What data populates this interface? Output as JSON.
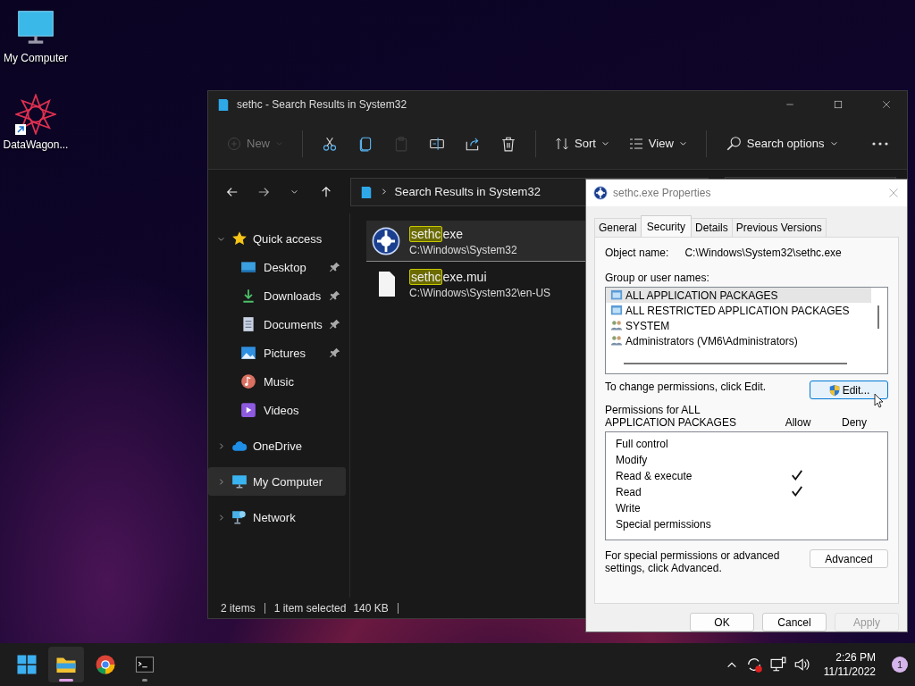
{
  "desktop_icons": [
    {
      "label": "My Computer",
      "kind": "computer",
      "shortcut": false
    },
    {
      "label": "DataWagon...",
      "kind": "app",
      "shortcut": true
    }
  ],
  "explorer": {
    "title": "sethc - Search Results in System32",
    "toolbar": [
      {
        "kind": "new",
        "label": "New",
        "disabled": true,
        "dropdown": true
      },
      {
        "kind": "divider"
      },
      {
        "kind": "cut",
        "disabled": false
      },
      {
        "kind": "copy",
        "disabled": false
      },
      {
        "kind": "paste",
        "disabled": true
      },
      {
        "kind": "rename",
        "disabled": false
      },
      {
        "kind": "share",
        "disabled": false
      },
      {
        "kind": "delete",
        "disabled": false
      },
      {
        "kind": "divider"
      },
      {
        "kind": "sort",
        "label": "Sort",
        "disabled": false,
        "dropdown": true
      },
      {
        "kind": "view",
        "label": "View",
        "disabled": false,
        "dropdown": true
      },
      {
        "kind": "divider"
      },
      {
        "kind": "search",
        "label": "Search options",
        "disabled": false,
        "dropdown": true
      },
      {
        "kind": "more",
        "disabled": false
      }
    ],
    "address": "Search Results in System32",
    "nav": [
      {
        "label": "Quick access",
        "expanded": true,
        "selected": false,
        "children": [
          {
            "label": "Desktop",
            "pinned": true,
            "selected": false
          },
          {
            "label": "Downloads",
            "pinned": true,
            "selected": false
          },
          {
            "label": "Documents",
            "pinned": true,
            "selected": false
          },
          {
            "label": "Pictures",
            "pinned": true,
            "selected": false
          },
          {
            "label": "Music",
            "pinned": false,
            "selected": false
          },
          {
            "label": "Videos",
            "pinned": false,
            "selected": false
          }
        ]
      },
      {
        "label": "OneDrive",
        "expanded": false,
        "selected": false
      },
      {
        "label": "My Computer",
        "expanded": false,
        "selected": true
      },
      {
        "label": "Network",
        "expanded": false,
        "selected": false
      }
    ],
    "files": [
      {
        "match": "sethc",
        "rest": "exe",
        "path": "C:\\Windows\\System32",
        "kind": "program",
        "selected": true
      },
      {
        "match": "sethc",
        "rest": "exe.mui",
        "path": "C:\\Windows\\System32\\en-US",
        "kind": "file",
        "selected": false
      }
    ],
    "status": [
      "2 items",
      "1 item selected",
      "140 KB"
    ]
  },
  "dialog": {
    "title": "sethc.exe Properties",
    "tabs": [
      {
        "label": "General",
        "selected": false
      },
      {
        "label": "Security",
        "selected": true
      },
      {
        "label": "Details",
        "selected": false
      },
      {
        "label": "Previous Versions",
        "selected": false
      }
    ],
    "object_label": "Object name:",
    "object_value": "C:\\Windows\\System32\\sethc.exe",
    "group_label": "Group or user names:",
    "principals": [
      {
        "name": "ALL APPLICATION PACKAGES",
        "kind": "package",
        "selected": true
      },
      {
        "name": "ALL RESTRICTED APPLICATION PACKAGES",
        "kind": "package",
        "selected": false
      },
      {
        "name": "SYSTEM",
        "kind": "group",
        "selected": false
      },
      {
        "name": "Administrators (VM6\\Administrators)",
        "kind": "group",
        "selected": false
      }
    ],
    "edit_hint": "To change permissions, click Edit.",
    "edit_button": "Edit...",
    "perm_header": "Permissions for ALL APPLICATION PACKAGES",
    "allow_label": "Allow",
    "deny_label": "Deny",
    "permissions": [
      {
        "name": "Full control",
        "allow": false,
        "deny": false
      },
      {
        "name": "Modify",
        "allow": false,
        "deny": false
      },
      {
        "name": "Read & execute",
        "allow": true,
        "deny": false
      },
      {
        "name": "Read",
        "allow": true,
        "deny": false
      },
      {
        "name": "Write",
        "allow": false,
        "deny": false
      },
      {
        "name": "Special permissions",
        "allow": false,
        "deny": false
      }
    ],
    "advanced_hint": "For special permissions or advanced settings, click Advanced.",
    "advanced_button": "Advanced",
    "buttons": [
      {
        "label": "OK",
        "disabled": false
      },
      {
        "label": "Cancel",
        "disabled": false
      },
      {
        "label": "Apply",
        "disabled": true
      }
    ]
  },
  "taskbar": {
    "apps": [
      {
        "kind": "start",
        "active": false,
        "running": false
      },
      {
        "kind": "explorer",
        "active": true,
        "running": true
      },
      {
        "kind": "chrome",
        "active": false,
        "running": false
      },
      {
        "kind": "terminal",
        "active": false,
        "running": true
      }
    ],
    "time": "2:26 PM",
    "date": "11/11/2022",
    "notifications": "1"
  }
}
